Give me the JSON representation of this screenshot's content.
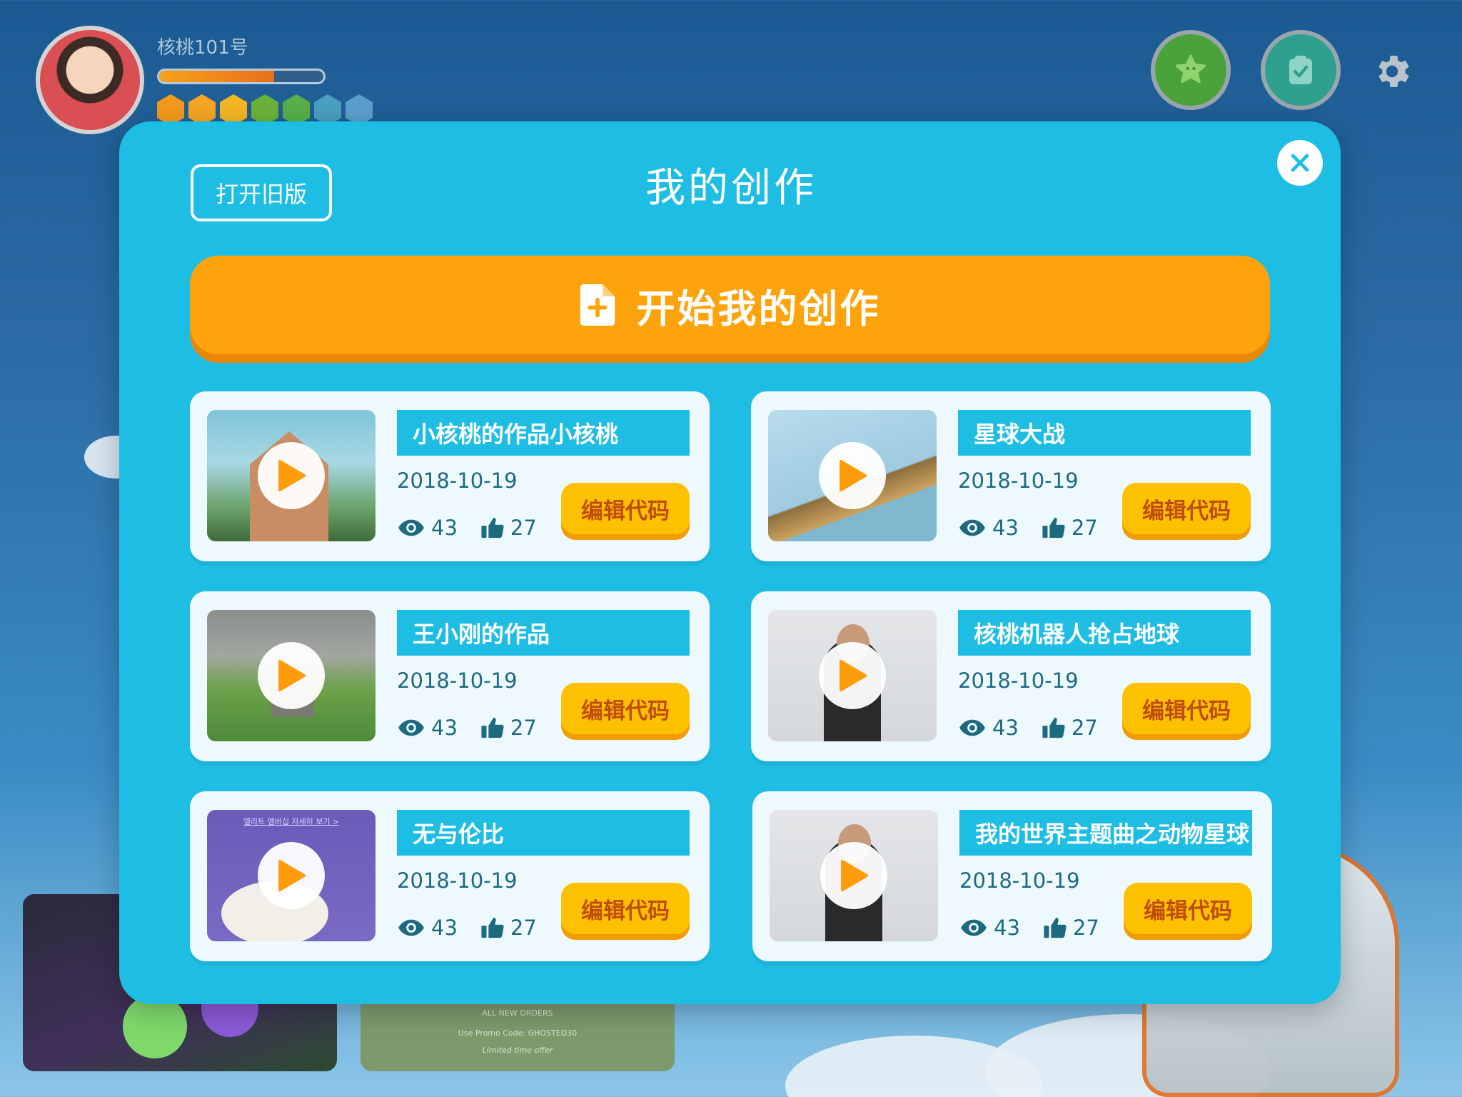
{
  "user": {
    "name": "核桃101号",
    "xp_progress": 0.7,
    "badge_colors": [
      "#f39a1c",
      "#f5a623",
      "#f5b623",
      "#6bb33a",
      "#58b04a",
      "#4aa0c0",
      "#5b9fce"
    ]
  },
  "top_buttons": [
    "star-icon",
    "checklist-icon",
    "gear-icon"
  ],
  "modal": {
    "title": "我的创作",
    "old_version_label": "打开旧版",
    "start_label": "开始我的创作",
    "close_icon": "close-icon"
  },
  "works": [
    {
      "title": "小核桃的作品小核桃",
      "date": "2018-10-19",
      "views": "43",
      "likes": "27",
      "edit_label": "编辑代码",
      "thumb": "castle"
    },
    {
      "title": "星球大战",
      "date": "2018-10-19",
      "views": "43",
      "likes": "27",
      "edit_label": "编辑代码",
      "thumb": "rail"
    },
    {
      "title": "王小刚的作品",
      "date": "2018-10-19",
      "views": "43",
      "likes": "27",
      "edit_label": "编辑代码",
      "thumb": "hills"
    },
    {
      "title": "核桃机器人抢占地球",
      "date": "2018-10-19",
      "views": "43",
      "likes": "27",
      "edit_label": "编辑代码",
      "thumb": "person"
    },
    {
      "title": "无与伦比",
      "date": "2018-10-19",
      "views": "43",
      "likes": "27",
      "edit_label": "编辑代码",
      "thumb": "ghost",
      "thumb_caption": "엘리트 멤버십 자세히 보기 >"
    },
    {
      "title": "我的世界主题曲之动物星球",
      "date": "2018-10-19",
      "views": "43",
      "likes": "27",
      "edit_label": "编辑代码",
      "thumb": "person"
    }
  ],
  "background": {
    "promo_lines": [
      "ALL NEW ORDERS",
      "Use Promo Code: GHOSTED30",
      "Limited time offer"
    ]
  },
  "colors": {
    "modal": "#1ebde4",
    "start_button": "#fea30b",
    "edit_button": "#fec100",
    "edit_text": "#c04c0c",
    "stat_text": "#1d6a80"
  }
}
